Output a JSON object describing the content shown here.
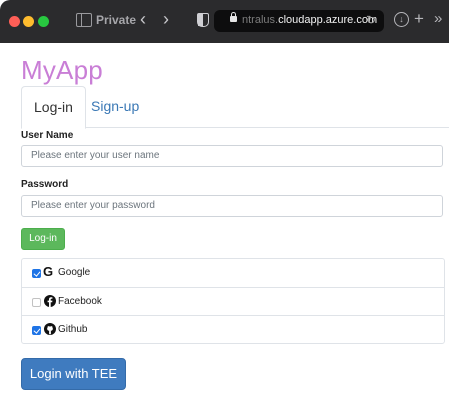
{
  "browser": {
    "private_label": "Private",
    "url_dim": "ntralus.",
    "url_main": "cloudapp.azure.com",
    "reload_icon": "reload-icon",
    "overflow_label": "»"
  },
  "app": {
    "title": "MyApp",
    "accent_color": "#c97ed6"
  },
  "tabs": [
    {
      "label": "Log-in",
      "active": true
    },
    {
      "label": "Sign-up",
      "active": false
    }
  ],
  "form": {
    "username_label": "User Name",
    "username_placeholder": "Please enter your user name",
    "password_label": "Password",
    "password_placeholder": "Please enter your password",
    "login_button": "Log-in",
    "login_button_color": "#5cb85c"
  },
  "providers": [
    {
      "name": "Google",
      "checked": true,
      "icon": "google-icon"
    },
    {
      "name": "Facebook",
      "checked": false,
      "icon": "facebook-icon"
    },
    {
      "name": "Github",
      "checked": true,
      "icon": "github-icon"
    }
  ],
  "tee_button": {
    "label": "Login with TEE",
    "color": "#3f7bbf"
  }
}
